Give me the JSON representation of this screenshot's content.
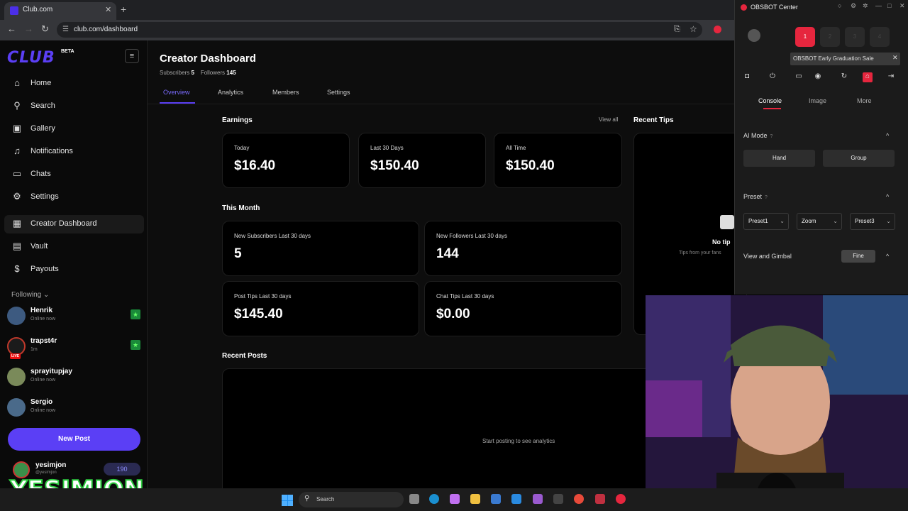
{
  "browser": {
    "tab_title": "Club.com",
    "url": "club.com/dashboard",
    "tab_close": "✕",
    "new_tab": "+",
    "back": "←",
    "forward": "→",
    "reload": "↻"
  },
  "sidebar": {
    "logo": "CLUB",
    "beta": "BETA",
    "menu_icon": "≡",
    "items": [
      {
        "label": "Home",
        "icon": "⌂"
      },
      {
        "label": "Search",
        "icon": "⚲"
      },
      {
        "label": "Gallery",
        "icon": "▣"
      },
      {
        "label": "Notifications",
        "icon": "♫"
      },
      {
        "label": "Chats",
        "icon": "▭"
      },
      {
        "label": "Settings",
        "icon": "⚙"
      },
      {
        "label": "Creator Dashboard",
        "icon": "▦"
      },
      {
        "label": "Vault",
        "icon": "▤"
      },
      {
        "label": "Payouts",
        "icon": "$"
      }
    ],
    "following_label": "Following ⌄",
    "following": [
      {
        "name": "Henrik",
        "status": "Online now",
        "color": "#3d5a80"
      },
      {
        "name": "trapst4r",
        "status": "1m",
        "color": "#c0392b"
      },
      {
        "name": "sprayitupjay",
        "status": "Online now",
        "color": "#7a8a5a"
      },
      {
        "name": "Sergio",
        "status": "Online now",
        "color": "#4a6a8a"
      }
    ],
    "live_badge": "LIVE",
    "star_icon": "★",
    "new_post": "New Post",
    "profile": {
      "name": "yesimjon",
      "handle": "@yesimjon",
      "coins": "190"
    },
    "overlay_text": "YESIMJON"
  },
  "main": {
    "title": "Creator Dashboard",
    "subscribers_label": "Subscribers",
    "subscribers": "5",
    "followers_label": "Followers",
    "followers": "145",
    "tabs": [
      "Overview",
      "Analytics",
      "Members",
      "Settings"
    ],
    "earnings_title": "Earnings",
    "view_all": "View all",
    "earnings": [
      {
        "label": "Today",
        "value": "$16.40"
      },
      {
        "label": "Last 30 Days",
        "value": "$150.40"
      },
      {
        "label": "All Time",
        "value": "$150.40"
      }
    ],
    "month_title": "This Month",
    "month": [
      {
        "label": "New Subscribers Last 30 days",
        "value": "5"
      },
      {
        "label": "New Followers Last 30 days",
        "value": "144"
      },
      {
        "label": "Post Tips Last 30 days",
        "value": "$145.40"
      },
      {
        "label": "Chat Tips Last 30 days",
        "value": "$0.00"
      }
    ],
    "recent_tips_title": "Recent Tips",
    "no_tips": "No tip",
    "tips_sub": "Tips from your fans",
    "recent_posts_title": "Recent Posts",
    "empty_posts": "Start posting to see analytics"
  },
  "taskbar": {
    "search": "Search"
  },
  "obsbot": {
    "title": "OBSBOT Center",
    "slots": [
      "1",
      "2",
      "3",
      "4"
    ],
    "promo": "OBSBOT Early Graduation Sale",
    "tabs": [
      "Console",
      "Image",
      "More"
    ],
    "ai_mode": "AI Mode",
    "ai_buttons": [
      "Hand",
      "Group"
    ],
    "preset": "Preset",
    "presets": [
      "Preset1",
      "Zoom",
      "Preset3"
    ],
    "view_gimbal": "View and Gimbal",
    "fine": "Fine",
    "help_icon": "?",
    "collapse_icon": "^"
  }
}
